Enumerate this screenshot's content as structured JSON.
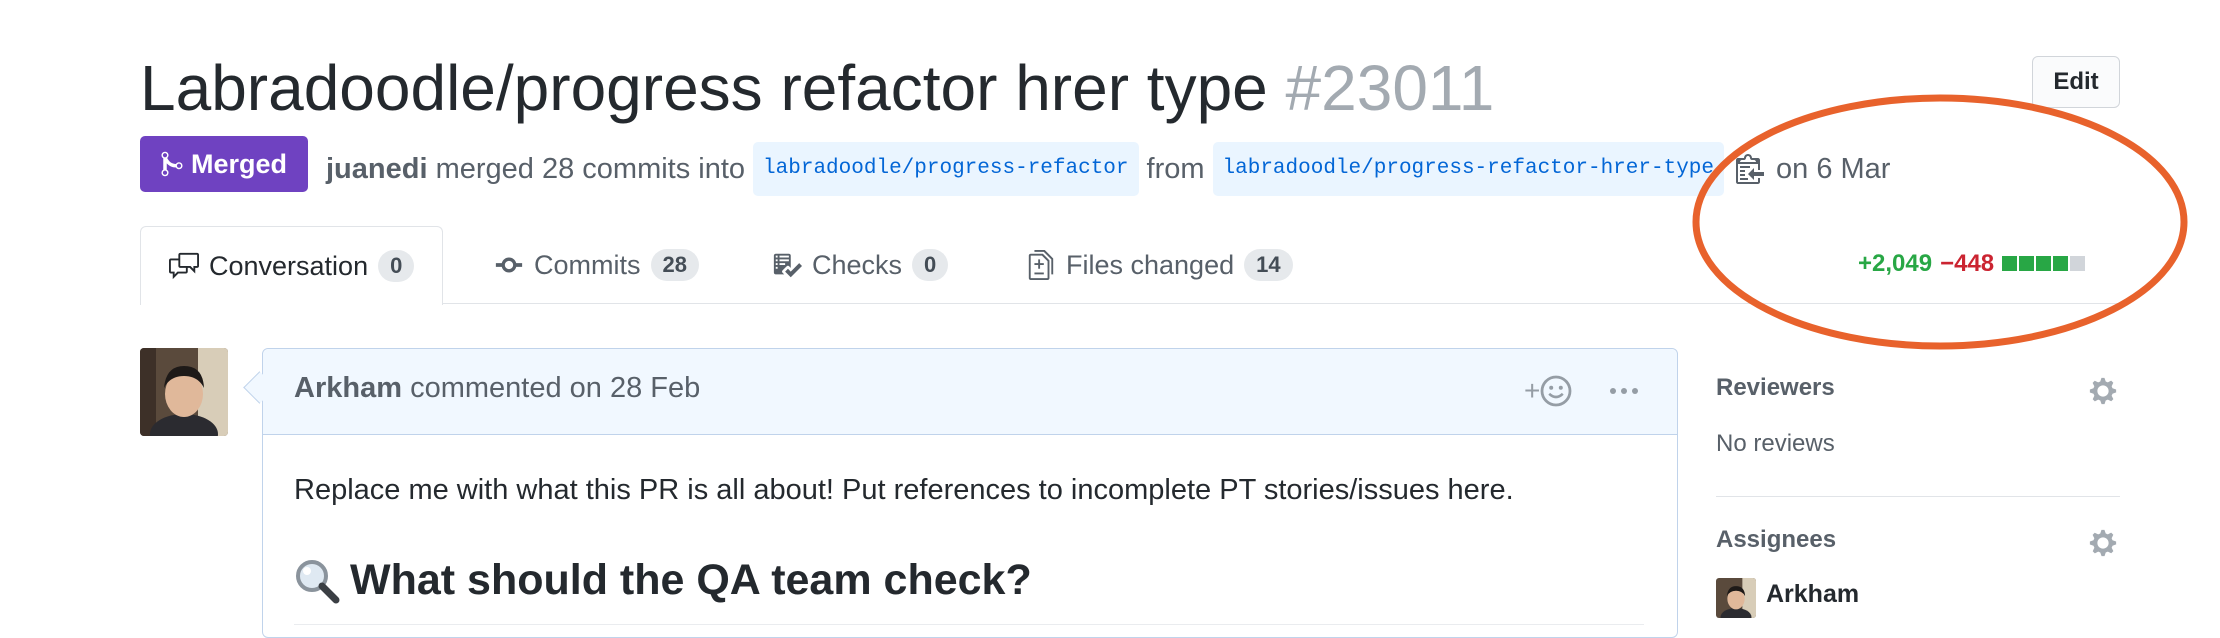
{
  "pr": {
    "title": "Labradoodle/progress refactor hrer type",
    "number": "#23011",
    "edit_label": "Edit",
    "status_label": "Merged",
    "author": "juanedi",
    "merged_text": "merged 28 commits into",
    "base_branch": "labradoodle/progress-refactor",
    "from_text": "from",
    "head_branch": "labradoodle/progress-refactor-hrer-type",
    "date_text": "on 6 Mar"
  },
  "tabs": [
    {
      "label": "Conversation",
      "count": "0",
      "icon": "comment-discussion-icon"
    },
    {
      "label": "Commits",
      "count": "28",
      "icon": "git-commit-icon"
    },
    {
      "label": "Checks",
      "count": "0",
      "icon": "checklist-icon"
    },
    {
      "label": "Files changed",
      "count": "14",
      "icon": "file-diff-icon"
    }
  ],
  "diffstat": {
    "additions": "+2,049",
    "deletions": "−448",
    "bars": [
      "green",
      "green",
      "green",
      "green",
      "gray"
    ],
    "add_color": "#28a745",
    "del_color": "#cb2431",
    "neutral_color": "#d1d5da"
  },
  "comment": {
    "author": "Arkham",
    "meta": "commented on 28 Feb",
    "reaction_label": "+",
    "body": "Replace me with what this PR is all about! Put references to incomplete PT stories/issues here.",
    "heading": "What should the QA team check?"
  },
  "sidebar": {
    "reviewers_title": "Reviewers",
    "reviewers_empty": "No reviews",
    "assignees_title": "Assignees",
    "assignee_name": "Arkham"
  },
  "colors": {
    "merged_purple": "#6f42c1",
    "annotation_orange": "#e8622c",
    "link_blue": "#0366d6"
  }
}
